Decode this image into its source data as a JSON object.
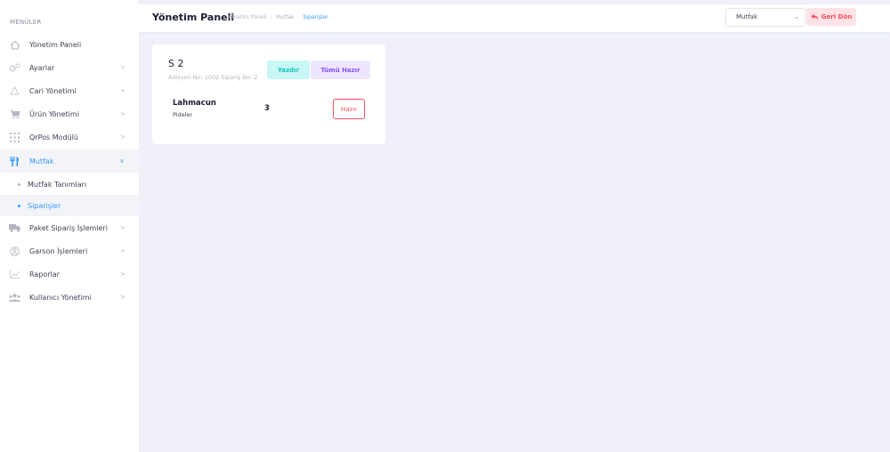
{
  "sidebar": {
    "heading": "MENÜLER",
    "items": [
      {
        "label": "Yönetim Paneli",
        "icon": "home-icon"
      },
      {
        "label": "Ayarlar",
        "icon": "gears-icon",
        "arrow": ">"
      },
      {
        "label": "Cari Yönetimi",
        "icon": "warning-icon",
        "arrow": ">"
      },
      {
        "label": "Ürün Yönetimi",
        "icon": "cart-icon",
        "arrow": ">"
      },
      {
        "label": "QrPos Modülü",
        "icon": "grid-icon",
        "arrow": ">"
      },
      {
        "label": "Mutfak",
        "icon": "utensils-icon",
        "arrow": "v"
      },
      {
        "label": "Paket Sipariş İşlemleri",
        "icon": "truck-icon",
        "arrow": ">"
      },
      {
        "label": "Garson İşlemleri",
        "icon": "user-circle-icon",
        "arrow": ">"
      },
      {
        "label": "Raporlar",
        "icon": "chart-line-icon",
        "arrow": ">"
      },
      {
        "label": "Kullanıcı Yönetimi",
        "icon": "users-icon",
        "arrow": ">"
      }
    ],
    "subitems": [
      {
        "label": "Mutfak Tanımları"
      },
      {
        "label": "Siparişler"
      }
    ]
  },
  "header": {
    "title": "Yönetim Paneli",
    "breadcrumb": [
      "Yönetim Paneli",
      "Mutfak",
      "Siparişler"
    ],
    "breadcrumb_sep": "-",
    "select_value": "Mutfak",
    "back_label": "Geri Dön"
  },
  "order": {
    "title": "S 2",
    "subtitle": "Adisyon No: 1002 Sipariş No: 2",
    "print_label": "Yazdır",
    "all_ready_label": "Tümü Hazır",
    "item": {
      "name": "Lahmacun",
      "description": "Pideler",
      "quantity": "3",
      "ready_label": "Hazır"
    }
  },
  "colors": {
    "accent": "#3699ff",
    "danger": "#f64e60",
    "info": "#8950fc",
    "success": "#1bc5bd",
    "background": "#eff0f8"
  }
}
